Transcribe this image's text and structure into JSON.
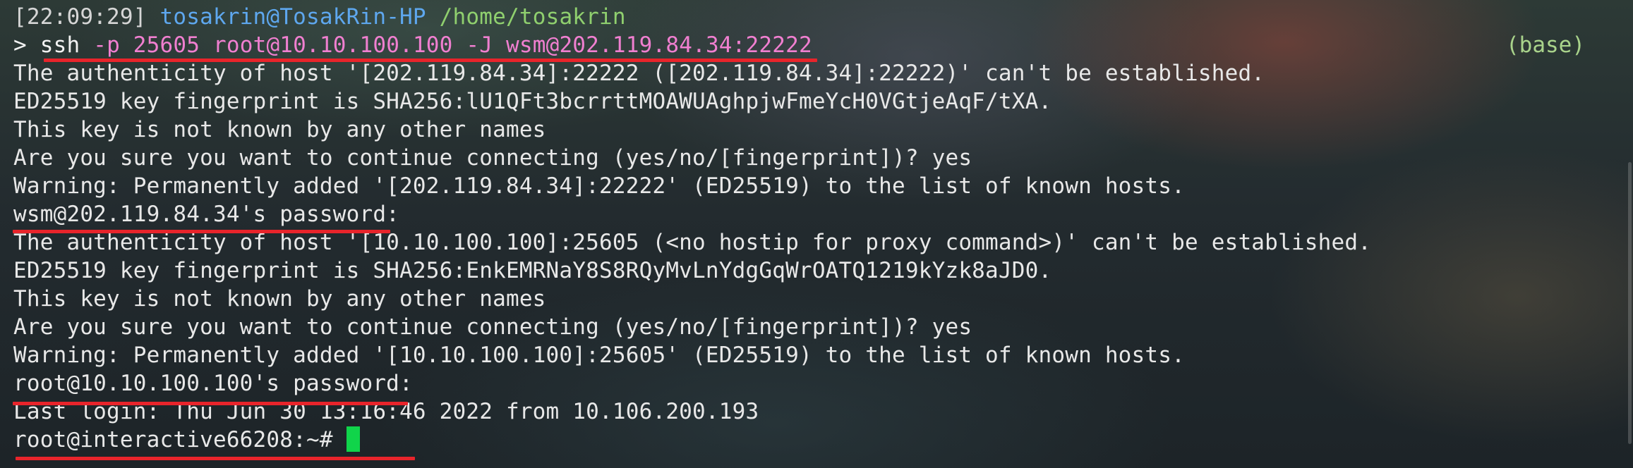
{
  "prompt": {
    "time": "[22:09:29]",
    "user_host": "tosakrin@TosakRin-HP",
    "cwd": "/home/tosakrin",
    "symbol": ">",
    "command_name": "ssh",
    "command_args": "-p 25605 root@10.10.100.100 -J wsm@202.119.84.34:22222",
    "conda_env": "(base)"
  },
  "output": {
    "l1": "The authenticity of host '[202.119.84.34]:22222 ([202.119.84.34]:22222)' can't be established.",
    "l2": "ED25519 key fingerprint is SHA256:lU1QFt3bcrrttMOAWUAghpjwFmeYcH0VGtjeAqF/tXA.",
    "l3": "This key is not known by any other names",
    "l4": "Are you sure you want to continue connecting (yes/no/[fingerprint])? yes",
    "l5": "Warning: Permanently added '[202.119.84.34]:22222' (ED25519) to the list of known hosts.",
    "l6": "wsm@202.119.84.34's password:",
    "l7": "The authenticity of host '[10.10.100.100]:25605 (<no hostip for proxy command>)' can't be established.",
    "l8": "ED25519 key fingerprint is SHA256:EnkEMRNaY8S8RQyMvLnYdgGqWrOATQ1219kYzk8aJD0.",
    "l9": "This key is not known by any other names",
    "l10": "Are you sure you want to continue connecting (yes/no/[fingerprint])? yes",
    "l11": "Warning: Permanently added '[10.10.100.100]:25605' (ED25519) to the list of known hosts.",
    "l12": "root@10.10.100.100's password:",
    "l13": "Last login: Thu Jun 30 13:16:46 2022 from 10.106.200.193",
    "l14": "root@interactive66208:~#"
  },
  "colors": {
    "annotation_underline": "#e8242b",
    "cursor": "#10d44a",
    "path": "#8fcf6e",
    "user_host": "#5ea7ee",
    "args": "#f07fd0"
  }
}
